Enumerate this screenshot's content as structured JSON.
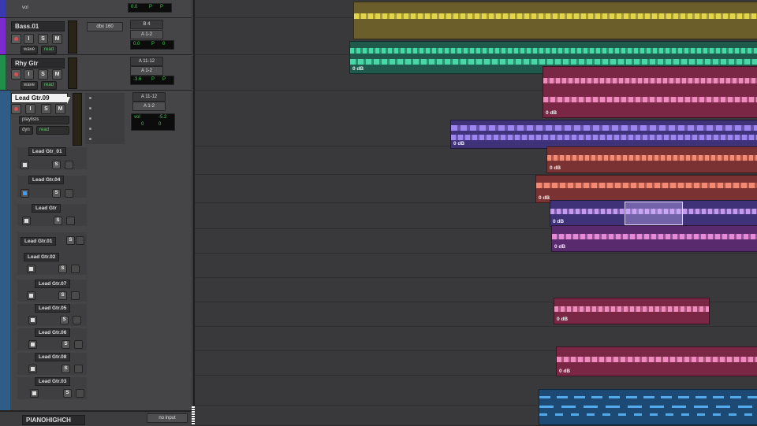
{
  "colors": {
    "bass": "#0c4fe0",
    "rhy": "#1f8f4a",
    "lead": "#2a8bd6",
    "yellow_clip": "#6b5e2a",
    "yellow_wave": "#e3d54a",
    "teal_clip": "#1f5a4d",
    "teal_wave": "#4ad6a6",
    "pink_clip": "#7a2745",
    "pink_wave": "#f08abf",
    "purple_clip": "#3f3278",
    "purple_wave": "#9e86f2",
    "salmon_clip": "#7a3332",
    "salmon_wave": "#f38a73",
    "blue_clip": "#1d4a75",
    "blue_wave": "#54a9ea"
  },
  "top_strip": {
    "vol": "vol",
    "value": "0.0",
    "p1": "P",
    "p2": "P"
  },
  "tracks": [
    {
      "name": "Bass.01",
      "buttons": [
        "I",
        "S",
        "M"
      ],
      "mode": "wave",
      "read": "read",
      "insert": "dbx 160",
      "io_top": "B 4",
      "io_out": "A 1-2",
      "vol": "0.0",
      "pan_left": "P",
      "pan_right": "0"
    },
    {
      "name": "Rhy Gtr",
      "buttons": [
        "I",
        "S",
        "M"
      ],
      "mode": "wave",
      "read": "read",
      "io_top": "A 11-12",
      "io_out": "A 1-2",
      "vol": "-3.6",
      "pan_left": "P",
      "pan_right": "P"
    },
    {
      "name": "Lead Gtr.09",
      "buttons": [
        "I",
        "S",
        "M"
      ],
      "mode": "playlists",
      "dyn": "dyn",
      "read": "read",
      "io_top": "A 11-12",
      "io_out": "A 1-2",
      "vol_label": "vol",
      "vol": "-5.2",
      "pan_left": "0",
      "pan_right": "0"
    }
  ],
  "lanes": [
    {
      "name": "Lead Gtr_01",
      "solo": "S"
    },
    {
      "name": "Lead Gtr.04",
      "solo": "S"
    },
    {
      "name": "Lead Gtr",
      "solo": "S"
    },
    {
      "name": "Lead Gtr.01",
      "solo": "S"
    },
    {
      "name": "Lead Gtr.02",
      "solo": "S"
    },
    {
      "name": "Lead Gtr.07",
      "solo": "S"
    },
    {
      "name": "Lead Gtr.05",
      "solo": "S"
    },
    {
      "name": "Lead Gtr.06",
      "solo": "S"
    },
    {
      "name": "Lead Gtr.08",
      "solo": "S"
    },
    {
      "name": "Lead Gtr.03",
      "solo": "S"
    }
  ],
  "bottom_track": {
    "name": "PIANOHIGHCH",
    "input": "no input"
  },
  "clip_gain": "0 dB"
}
